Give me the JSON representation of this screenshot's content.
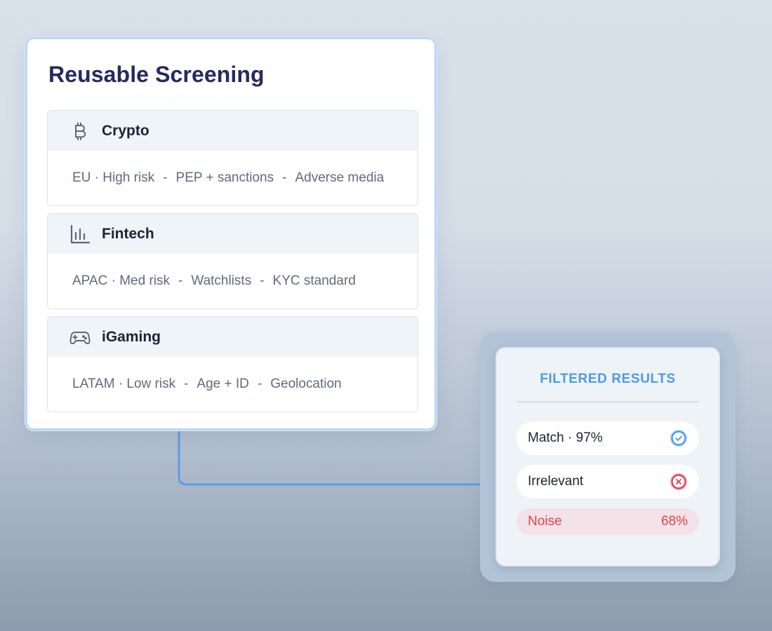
{
  "screening": {
    "title": "Reusable Screening",
    "cards": [
      {
        "name": "Crypto",
        "icon": "bitcoin-icon",
        "region": "EU · High risk",
        "check_1": "PEP + sanctions",
        "check_2": "Adverse media"
      },
      {
        "name": "Fintech",
        "icon": "bar-chart-icon",
        "region": "APAC · Med risk",
        "check_1": "Watchlists",
        "check_2": "KYC standard"
      },
      {
        "name": "iGaming",
        "icon": "gamepad-icon",
        "region": "LATAM · Low risk",
        "check_1": "Age + ID",
        "check_2": "Geolocation"
      }
    ],
    "separator": "-"
  },
  "results": {
    "title": "FILTERED RESULTS",
    "rows": [
      {
        "label": "Match · 97%",
        "status_icon": "check-circle-icon"
      },
      {
        "label": "Irrelevant",
        "status_icon": "x-circle-icon"
      }
    ],
    "noise": {
      "label": "Noise",
      "value": "68%"
    }
  },
  "colors": {
    "accent_blue": "#4c9be6",
    "title_navy": "#262a5e",
    "connector": "#5b9bf0",
    "noise_red": "#e0424f",
    "noise_bg": "#f3e2e7"
  }
}
